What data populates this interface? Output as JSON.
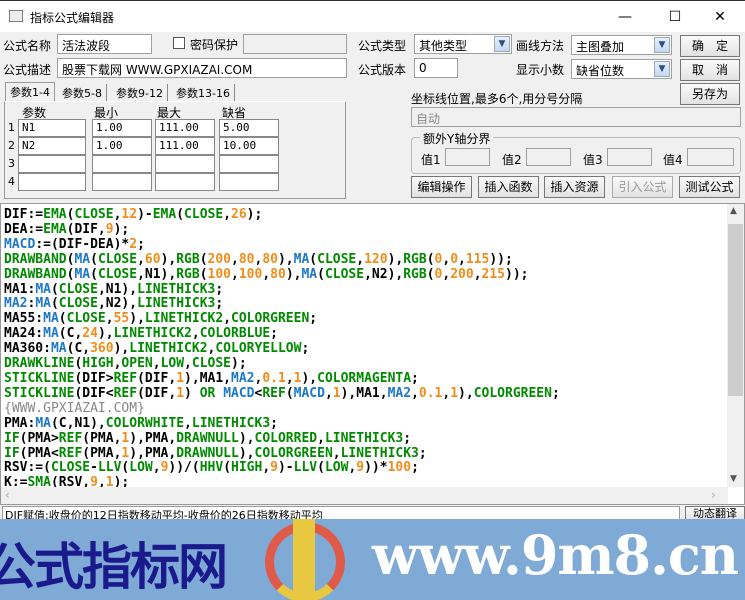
{
  "window": {
    "title": "指标公式编辑器",
    "minimize": "—",
    "maximize": "☐",
    "close": "✕"
  },
  "form": {
    "name_label": "公式名称",
    "name_value": "活法波段",
    "password_label": "密码保护",
    "password_checked": false,
    "desc_label": "公式描述",
    "desc_value": "股票下载网 WWW.GPXIAZAI.COM",
    "type_label": "公式类型",
    "type_value": "其他类型",
    "version_label": "公式版本",
    "version_value": "0",
    "draw_label": "画线方法",
    "draw_value": "主图叠加",
    "decimal_label": "显示小数",
    "decimal_value": "缺省位数",
    "ok": "确　定",
    "cancel": "取　消",
    "save_as": "另存为",
    "axis_label": "坐标线位置,最多6个,用分号分隔",
    "axis_placeholder": "自动",
    "ygroup_label": "额外Y轴分界",
    "v1": "值1",
    "v2": "值2",
    "v3": "值3",
    "v4": "值4",
    "btn_edit": "编辑操作",
    "btn_func": "插入函数",
    "btn_res": "插入资源",
    "btn_import": "引入公式",
    "btn_test": "测试公式"
  },
  "params": {
    "tabs": [
      "参数1-4",
      "参数5-8",
      "参数9-12",
      "参数13-16"
    ],
    "headers": [
      "参数",
      "最小",
      "最大",
      "缺省"
    ],
    "rows": [
      {
        "idx": "1",
        "name": "N1",
        "min": "1.00",
        "max": "111.00",
        "def": "5.00"
      },
      {
        "idx": "2",
        "name": "N2",
        "min": "1.00",
        "max": "111.00",
        "def": "10.00"
      },
      {
        "idx": "3",
        "name": "",
        "min": "",
        "max": "",
        "def": ""
      },
      {
        "idx": "4",
        "name": "",
        "min": "",
        "max": "",
        "def": ""
      }
    ]
  },
  "code_lines": [
    [
      [
        "k",
        "DIF:="
      ],
      [
        "g",
        "EMA"
      ],
      [
        "k",
        "("
      ],
      [
        "g",
        "CLOSE"
      ],
      [
        "k",
        ","
      ],
      [
        "o",
        "12"
      ],
      [
        "k",
        ")-"
      ],
      [
        "g",
        "EMA"
      ],
      [
        "k",
        "("
      ],
      [
        "g",
        "CLOSE"
      ],
      [
        "k",
        ","
      ],
      [
        "o",
        "26"
      ],
      [
        "k",
        ");"
      ]
    ],
    [
      [
        "k",
        "DEA:="
      ],
      [
        "g",
        "EMA"
      ],
      [
        "k",
        "(DIF,"
      ],
      [
        "o",
        "9"
      ],
      [
        "k",
        ");"
      ]
    ],
    [
      [
        "b",
        "MACD"
      ],
      [
        "k",
        ":=(DIF-DEA)*"
      ],
      [
        "o",
        "2"
      ],
      [
        "k",
        ";"
      ]
    ],
    [
      [
        "g",
        "DRAWBAND"
      ],
      [
        "k",
        "("
      ],
      [
        "b",
        "MA"
      ],
      [
        "k",
        "("
      ],
      [
        "g",
        "CLOSE"
      ],
      [
        "k",
        ","
      ],
      [
        "o",
        "60"
      ],
      [
        "k",
        "),"
      ],
      [
        "g",
        "RGB"
      ],
      [
        "k",
        "("
      ],
      [
        "o",
        "200"
      ],
      [
        "k",
        ","
      ],
      [
        "o",
        "80"
      ],
      [
        "k",
        ","
      ],
      [
        "o",
        "80"
      ],
      [
        "k",
        "),"
      ],
      [
        "b",
        "MA"
      ],
      [
        "k",
        "("
      ],
      [
        "g",
        "CLOSE"
      ],
      [
        "k",
        ","
      ],
      [
        "o",
        "120"
      ],
      [
        "k",
        "),"
      ],
      [
        "g",
        "RGB"
      ],
      [
        "k",
        "("
      ],
      [
        "o",
        "0"
      ],
      [
        "k",
        ","
      ],
      [
        "o",
        "0"
      ],
      [
        "k",
        ","
      ],
      [
        "o",
        "115"
      ],
      [
        "k",
        "));"
      ]
    ],
    [
      [
        "g",
        "DRAWBAND"
      ],
      [
        "k",
        "("
      ],
      [
        "b",
        "MA"
      ],
      [
        "k",
        "("
      ],
      [
        "g",
        "CLOSE"
      ],
      [
        "k",
        ",N1),"
      ],
      [
        "g",
        "RGB"
      ],
      [
        "k",
        "("
      ],
      [
        "o",
        "100"
      ],
      [
        "k",
        ","
      ],
      [
        "o",
        "100"
      ],
      [
        "k",
        ","
      ],
      [
        "o",
        "80"
      ],
      [
        "k",
        "),"
      ],
      [
        "b",
        "MA"
      ],
      [
        "k",
        "("
      ],
      [
        "g",
        "CLOSE"
      ],
      [
        "k",
        ",N2),"
      ],
      [
        "g",
        "RGB"
      ],
      [
        "k",
        "("
      ],
      [
        "o",
        "0"
      ],
      [
        "k",
        ","
      ],
      [
        "o",
        "200"
      ],
      [
        "k",
        ","
      ],
      [
        "o",
        "215"
      ],
      [
        "k",
        "));"
      ]
    ],
    [
      [
        "k",
        "MA1:"
      ],
      [
        "b",
        "MA"
      ],
      [
        "k",
        "("
      ],
      [
        "g",
        "CLOSE"
      ],
      [
        "k",
        ",N1),"
      ],
      [
        "g",
        "LINETHICK3"
      ],
      [
        "k",
        ";"
      ]
    ],
    [
      [
        "b",
        "MA2"
      ],
      [
        "k",
        ":"
      ],
      [
        "b",
        "MA"
      ],
      [
        "k",
        "("
      ],
      [
        "g",
        "CLOSE"
      ],
      [
        "k",
        ",N2),"
      ],
      [
        "g",
        "LINETHICK3"
      ],
      [
        "k",
        ";"
      ]
    ],
    [
      [
        "k",
        "MA55:"
      ],
      [
        "b",
        "MA"
      ],
      [
        "k",
        "("
      ],
      [
        "g",
        "CLOSE"
      ],
      [
        "k",
        ","
      ],
      [
        "o",
        "55"
      ],
      [
        "k",
        "),"
      ],
      [
        "g",
        "LINETHICK2"
      ],
      [
        "k",
        ","
      ],
      [
        "g",
        "COLORGREEN"
      ],
      [
        "k",
        ";"
      ]
    ],
    [
      [
        "k",
        "MA24:"
      ],
      [
        "b",
        "MA"
      ],
      [
        "k",
        "(C,"
      ],
      [
        "o",
        "24"
      ],
      [
        "k",
        "),"
      ],
      [
        "g",
        "LINETHICK2"
      ],
      [
        "k",
        ","
      ],
      [
        "g",
        "COLORBLUE"
      ],
      [
        "k",
        ";"
      ]
    ],
    [
      [
        "k",
        "MA360:"
      ],
      [
        "b",
        "MA"
      ],
      [
        "k",
        "(C,"
      ],
      [
        "o",
        "360"
      ],
      [
        "k",
        "),"
      ],
      [
        "g",
        "LINETHICK2"
      ],
      [
        "k",
        ","
      ],
      [
        "g",
        "COLORYELLOW"
      ],
      [
        "k",
        ";"
      ]
    ],
    [
      [
        "g",
        "DRAWKLINE"
      ],
      [
        "k",
        "("
      ],
      [
        "g",
        "HIGH"
      ],
      [
        "k",
        ","
      ],
      [
        "g",
        "OPEN"
      ],
      [
        "k",
        ","
      ],
      [
        "g",
        "LOW"
      ],
      [
        "k",
        ","
      ],
      [
        "g",
        "CLOSE"
      ],
      [
        "k",
        ");"
      ]
    ],
    [
      [
        "g",
        "STICKLINE"
      ],
      [
        "k",
        "(DIF>"
      ],
      [
        "g",
        "REF"
      ],
      [
        "k",
        "(DIF,"
      ],
      [
        "o",
        "1"
      ],
      [
        "k",
        "),MA1,"
      ],
      [
        "b",
        "MA2"
      ],
      [
        "k",
        ","
      ],
      [
        "o",
        "0.1"
      ],
      [
        "k",
        ","
      ],
      [
        "o",
        "1"
      ],
      [
        "k",
        "),"
      ],
      [
        "g",
        "COLORMAGENTA"
      ],
      [
        "k",
        ";"
      ]
    ],
    [
      [
        "g",
        "STICKLINE"
      ],
      [
        "k",
        "(DIF<"
      ],
      [
        "g",
        "REF"
      ],
      [
        "k",
        "(DIF,"
      ],
      [
        "o",
        "1"
      ],
      [
        "k",
        ") "
      ],
      [
        "g",
        "OR"
      ],
      [
        "k",
        " "
      ],
      [
        "b",
        "MACD"
      ],
      [
        "k",
        "<"
      ],
      [
        "g",
        "REF"
      ],
      [
        "k",
        "("
      ],
      [
        "b",
        "MACD"
      ],
      [
        "k",
        ","
      ],
      [
        "o",
        "1"
      ],
      [
        "k",
        "),MA1,"
      ],
      [
        "b",
        "MA2"
      ],
      [
        "k",
        ","
      ],
      [
        "o",
        "0.1"
      ],
      [
        "k",
        ","
      ],
      [
        "o",
        "1"
      ],
      [
        "k",
        "),"
      ],
      [
        "g",
        "COLORGREEN"
      ],
      [
        "k",
        ";"
      ]
    ],
    [
      [
        "c",
        "{WWW.GPXIAZAI.COM}"
      ]
    ],
    [
      [
        "k",
        "PMA:"
      ],
      [
        "b",
        "MA"
      ],
      [
        "k",
        "(C,N1),"
      ],
      [
        "g",
        "COLORWHITE"
      ],
      [
        "k",
        ","
      ],
      [
        "g",
        "LINETHICK3"
      ],
      [
        "k",
        ";"
      ]
    ],
    [
      [
        "g",
        "IF"
      ],
      [
        "k",
        "(PMA>"
      ],
      [
        "g",
        "REF"
      ],
      [
        "k",
        "(PMA,"
      ],
      [
        "o",
        "1"
      ],
      [
        "k",
        "),PMA,"
      ],
      [
        "g",
        "DRAWNULL"
      ],
      [
        "k",
        "),"
      ],
      [
        "g",
        "COLORRED"
      ],
      [
        "k",
        ","
      ],
      [
        "g",
        "LINETHICK3"
      ],
      [
        "k",
        ";"
      ]
    ],
    [
      [
        "g",
        "IF"
      ],
      [
        "k",
        "(PMA<"
      ],
      [
        "g",
        "REF"
      ],
      [
        "k",
        "(PMA,"
      ],
      [
        "o",
        "1"
      ],
      [
        "k",
        "),PMA,"
      ],
      [
        "g",
        "DRAWNULL"
      ],
      [
        "k",
        "),"
      ],
      [
        "g",
        "COLORGREEN"
      ],
      [
        "k",
        ","
      ],
      [
        "g",
        "LINETHICK3"
      ],
      [
        "k",
        ";"
      ]
    ],
    [
      [
        "k",
        "RSV:=("
      ],
      [
        "g",
        "CLOSE"
      ],
      [
        "k",
        "-"
      ],
      [
        "g",
        "LLV"
      ],
      [
        "k",
        "("
      ],
      [
        "g",
        "LOW"
      ],
      [
        "k",
        ","
      ],
      [
        "o",
        "9"
      ],
      [
        "k",
        "))/("
      ],
      [
        "g",
        "HHV"
      ],
      [
        "k",
        "("
      ],
      [
        "g",
        "HIGH"
      ],
      [
        "k",
        ","
      ],
      [
        "o",
        "9"
      ],
      [
        "k",
        ")-"
      ],
      [
        "g",
        "LLV"
      ],
      [
        "k",
        "("
      ],
      [
        "g",
        "LOW"
      ],
      [
        "k",
        ","
      ],
      [
        "o",
        "9"
      ],
      [
        "k",
        "))*"
      ],
      [
        "o",
        "100"
      ],
      [
        "k",
        ";"
      ]
    ],
    [
      [
        "k",
        "K:="
      ],
      [
        "g",
        "SMA"
      ],
      [
        "k",
        "(RSV,"
      ],
      [
        "o",
        "9"
      ],
      [
        "k",
        ","
      ],
      [
        "o",
        "1"
      ],
      [
        "k",
        ");"
      ]
    ]
  ],
  "status": {
    "text": "DIF赋值:收盘价的12日指数移动平均-收盘价的26日指数移动平均",
    "translate_btn": "动态翻译"
  },
  "banner": {
    "left_text": "公式指标网",
    "url": "www.9m8.cn",
    "bg": "#7faad6"
  }
}
